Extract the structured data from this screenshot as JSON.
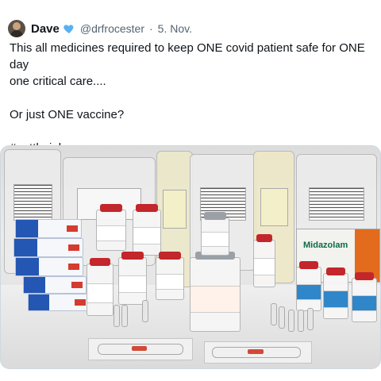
{
  "tweet": {
    "author_name": "Dave",
    "author_handle": "@drfrocester",
    "separator": "·",
    "date": "5. Nov.",
    "text_lines": [
      "This all medicines required to keep ONE covid patient safe for ONE day",
      "one critical care....",
      "",
      "Or just ONE vaccine?",
      "",
      "#getthejab"
    ],
    "verified_icon": "blue-heart-icon",
    "verified_color": "#5ab0f0"
  },
  "media": {
    "box_label": "Midazolam"
  }
}
